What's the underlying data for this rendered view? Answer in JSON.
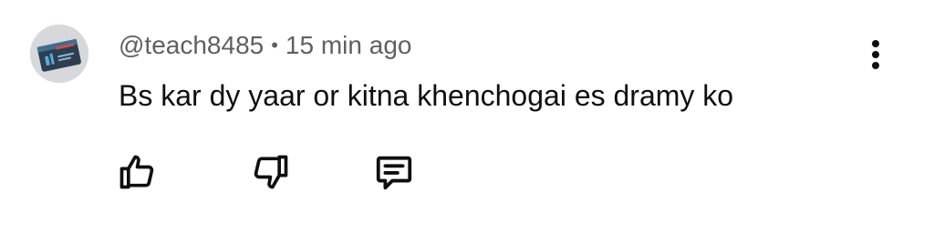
{
  "comment": {
    "author": "@teach8485",
    "separator": "•",
    "timestamp": "15 min ago",
    "text": "Bs kar dy yaar or kitna khenchogai es dramy ko"
  },
  "icons": {
    "more": "more-vert-icon",
    "like": "thumbs-up-icon",
    "dislike": "thumbs-down-icon",
    "reply": "reply-comment-icon"
  },
  "colors": {
    "text": "#0f0f0f",
    "secondary": "#606060"
  }
}
